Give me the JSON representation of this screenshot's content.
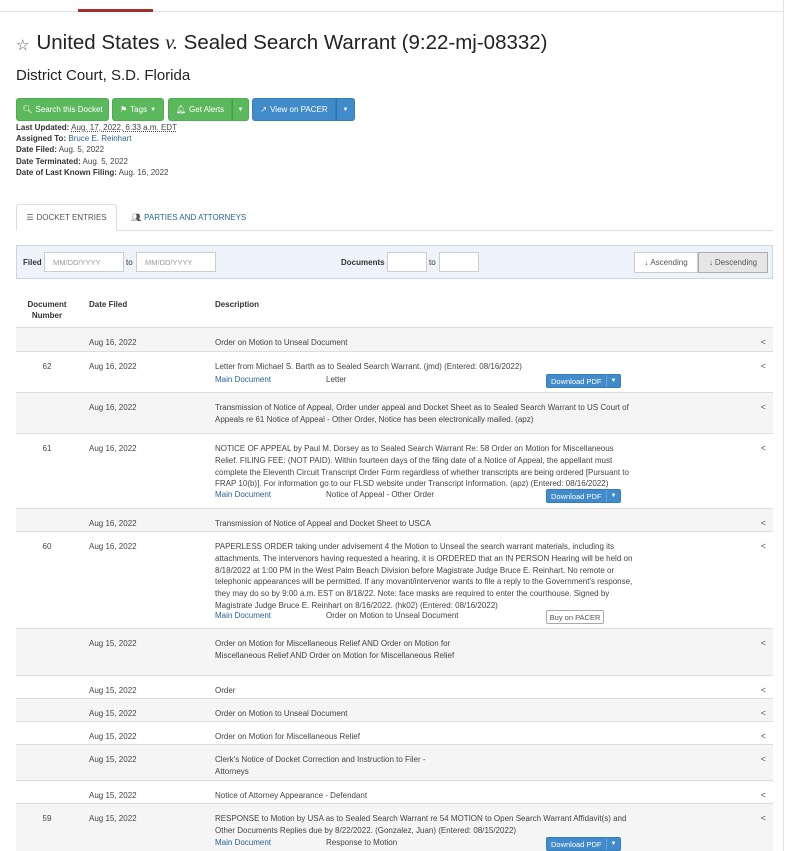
{
  "case": {
    "title_part1": "United States",
    "title_v": "v.",
    "title_part2": "Sealed Search Warrant (9:22-mj-08332)",
    "court": "District Court, S.D. Florida"
  },
  "buttons": {
    "search_docket": "Search this Docket",
    "tags": "Tags",
    "get_alerts": "Get Alerts",
    "view_on_pacer": "View on PACER"
  },
  "meta": {
    "last_updated_label": "Last Updated:",
    "last_updated_value": "Aug. 17, 2022, 6:33 a.m. EDT",
    "assigned_to_label": "Assigned To:",
    "assigned_to_value": "Bruce E. Reinhart",
    "date_filed_label": "Date Filed:",
    "date_filed_value": "Aug. 5, 2022",
    "date_terminated_label": "Date Terminated:",
    "date_terminated_value": "Aug. 5, 2022",
    "last_filing_label": "Date of Last Known Filing:",
    "last_filing_value": "Aug. 16, 2022"
  },
  "tabs": {
    "docket_entries": "DOCKET ENTRIES",
    "parties": "PARTIES AND ATTORNEYS"
  },
  "filter": {
    "filed_label": "Filed",
    "date_placeholder": "MM/DD/YYYY",
    "to": "to",
    "documents_label": "Documents",
    "ascending": "Ascending",
    "descending": "Descending"
  },
  "table": {
    "col_doc_number_1": "Document",
    "col_doc_number_2": "Number",
    "col_date_filed": "Date Filed",
    "col_description": "Description"
  },
  "entries": [
    {
      "num": "",
      "date": "Aug 16, 2022",
      "desc": "Order on Motion to Unseal Document"
    },
    {
      "num": "62",
      "date": "Aug 16, 2022",
      "desc": "Letter from Michael S. Barth as to Sealed Search Warrant. (jmd) (Entered: 08/16/2022)",
      "doc_link": "Main Document",
      "doc_type": "Letter",
      "action": "Download PDF"
    },
    {
      "num": "",
      "date": "Aug 16, 2022",
      "desc": "Transmission of Notice of Appeal, Order under appeal and Docket Sheet as to Sealed Search Warrant to US Court of Appeals re 61 Notice of Appeal - Other Order, Notice has been electronically mailed. (apz)"
    },
    {
      "num": "61",
      "date": "Aug 16, 2022",
      "desc": "NOTICE OF APPEAL by Paul M. Dorsey as to Sealed Search Warrant Re: 58 Order on Motion for Miscellaneous Relief. FILING FEE: (NOT PAID). Within fourteen days of the filing date of a Notice of Appeal, the appellant must complete the Eleventh Circuit Transcript Order Form regardless of whether transcripts are being ordered [Pursuant to FRAP 10(b)]. For information go to our FLSD website under Transcript Information. (apz) (Entered: 08/16/2022)",
      "doc_link": "Main Document",
      "doc_type": "Notice of Appeal - Other Order",
      "action": "Download PDF"
    },
    {
      "num": "",
      "date": "Aug 16, 2022",
      "desc": "Transmission of Notice of Appeal and Docket Sheet to USCA"
    },
    {
      "num": "60",
      "date": "Aug 16, 2022",
      "desc": "PAPERLESS ORDER taking under advisement 4 the Motion to Unseal the search warrant materials, including its attachments. The intervenors having requested a hearing, it is ORDERED that an IN PERSON Hearing will be held on 8/18/2022 at 1:00 PM in the West Palm Beach Division before Magistrate Judge Bruce E. Reinhart. No remote or telephonic appearances will be permitted. If any movant/intervenor wants to file a reply to the Government's response, they may do so by 9:00 a.m. EST on 8/18/22. Note: face masks are required to enter the courthouse. Signed by Magistrate Judge Bruce E. Reinhart on 8/16/2022. (hk02) (Entered: 08/16/2022)",
      "doc_link": "Main Document",
      "doc_type": "Order on Motion to Unseal Document",
      "action": "Buy on PACER"
    },
    {
      "num": "",
      "date": "Aug 15, 2022",
      "desc": "Order on Motion for Miscellaneous Relief AND Order on Motion for Miscellaneous Relief AND Order on Motion for Miscellaneous Relief"
    },
    {
      "num": "",
      "date": "Aug 15, 2022",
      "desc": "Order"
    },
    {
      "num": "",
      "date": "Aug 15, 2022",
      "desc": "Order on Motion to Unseal Document"
    },
    {
      "num": "",
      "date": "Aug 15, 2022",
      "desc": "Order on Motion for Miscellaneous Relief"
    },
    {
      "num": "",
      "date": "Aug 15, 2022",
      "desc": "Clerk's Notice of Docket Correction and Instruction to Filer - Attorneys"
    },
    {
      "num": "",
      "date": "Aug 15, 2022",
      "desc": "Notice of Attorney Appearance - Defendant"
    },
    {
      "num": "59",
      "date": "Aug 15, 2022",
      "desc": "RESPONSE to Motion by USA as to Sealed Search Warrant re 54 MOTION to Open Search Warrant Affidavit(s) and Other Documents Replies due by 8/22/2022. (Gonzalez, Juan) (Entered: 08/15/2022)",
      "doc_link": "Main Document",
      "doc_type": "Response to Motion",
      "action": "Download PDF"
    }
  ]
}
